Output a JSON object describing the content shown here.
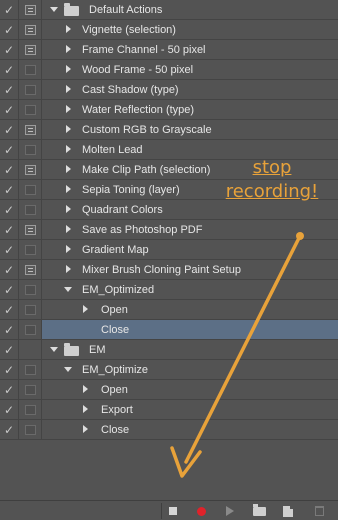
{
  "rows": [
    {
      "check": true,
      "dialog": "on",
      "type": "set",
      "expanded": true,
      "indent": 0,
      "label": "Default Actions"
    },
    {
      "check": true,
      "dialog": "on",
      "type": "action",
      "expanded": false,
      "indent": 1,
      "label": "Vignette (selection)"
    },
    {
      "check": true,
      "dialog": "on",
      "type": "action",
      "expanded": false,
      "indent": 1,
      "label": "Frame Channel - 50 pixel"
    },
    {
      "check": true,
      "dialog": "off",
      "type": "action",
      "expanded": false,
      "indent": 1,
      "label": "Wood Frame - 50 pixel"
    },
    {
      "check": true,
      "dialog": "off",
      "type": "action",
      "expanded": false,
      "indent": 1,
      "label": "Cast Shadow (type)"
    },
    {
      "check": true,
      "dialog": "off",
      "type": "action",
      "expanded": false,
      "indent": 1,
      "label": "Water Reflection (type)"
    },
    {
      "check": true,
      "dialog": "on",
      "type": "action",
      "expanded": false,
      "indent": 1,
      "label": "Custom RGB to Grayscale"
    },
    {
      "check": true,
      "dialog": "off",
      "type": "action",
      "expanded": false,
      "indent": 1,
      "label": "Molten Lead"
    },
    {
      "check": true,
      "dialog": "on",
      "type": "action",
      "expanded": false,
      "indent": 1,
      "label": "Make Clip Path (selection)"
    },
    {
      "check": true,
      "dialog": "off",
      "type": "action",
      "expanded": false,
      "indent": 1,
      "label": "Sepia Toning (layer)"
    },
    {
      "check": true,
      "dialog": "off",
      "type": "action",
      "expanded": false,
      "indent": 1,
      "label": "Quadrant Colors"
    },
    {
      "check": true,
      "dialog": "on",
      "type": "action",
      "expanded": false,
      "indent": 1,
      "label": "Save as Photoshop PDF"
    },
    {
      "check": true,
      "dialog": "off",
      "type": "action",
      "expanded": false,
      "indent": 1,
      "label": "Gradient Map"
    },
    {
      "check": true,
      "dialog": "on",
      "type": "action",
      "expanded": false,
      "indent": 1,
      "label": "Mixer Brush Cloning Paint Setup"
    },
    {
      "check": true,
      "dialog": "off",
      "type": "action",
      "expanded": true,
      "indent": 1,
      "label": "EM_Optimized"
    },
    {
      "check": true,
      "dialog": "off",
      "type": "step",
      "expanded": false,
      "indent": 2,
      "label": "Open"
    },
    {
      "check": true,
      "dialog": "off",
      "type": "step",
      "expanded": null,
      "indent": 2,
      "label": "Close",
      "selected": true
    },
    {
      "check": true,
      "dialog": "none",
      "type": "set",
      "expanded": true,
      "indent": 0,
      "label": "EM"
    },
    {
      "check": true,
      "dialog": "off",
      "type": "action",
      "expanded": true,
      "indent": 1,
      "label": "EM_Optimize"
    },
    {
      "check": true,
      "dialog": "off",
      "type": "step",
      "expanded": false,
      "indent": 2,
      "label": "Open"
    },
    {
      "check": true,
      "dialog": "off",
      "type": "step",
      "expanded": false,
      "indent": 2,
      "label": "Export"
    },
    {
      "check": true,
      "dialog": "off",
      "type": "step",
      "expanded": false,
      "indent": 2,
      "label": "Close"
    }
  ],
  "annotation": {
    "line1": "stop",
    "line2": "recording!",
    "color": "#e8a23a"
  },
  "toolbar": {
    "stop_icon": "stop-square-icon",
    "record_icon": "record-dot-icon",
    "play_icon": "play-icon",
    "new_set_icon": "folder-icon",
    "new_action_icon": "new-item-icon",
    "delete_icon": "trash-icon"
  },
  "colors": {
    "background": "#535353",
    "selection": "#5c6f86",
    "record": "#e0222a"
  }
}
